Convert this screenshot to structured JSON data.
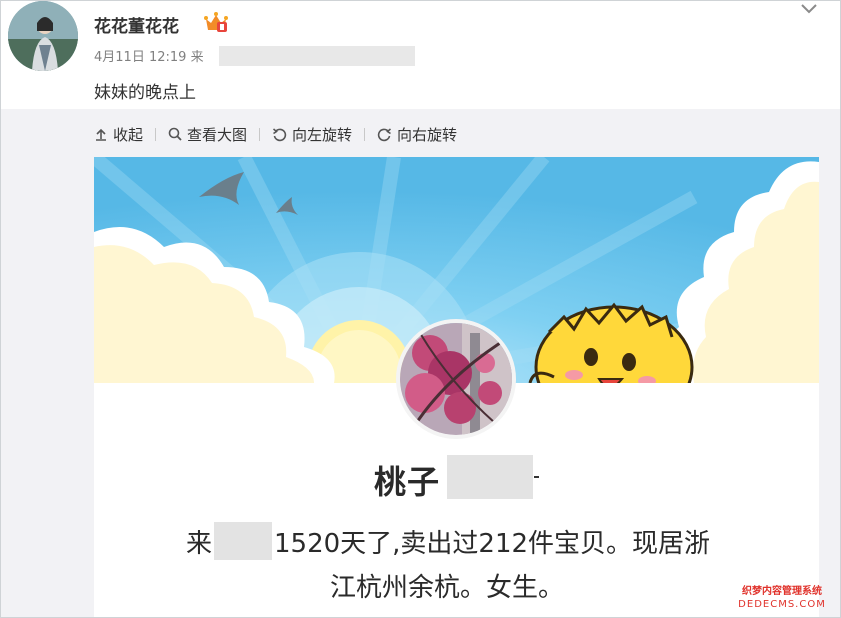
{
  "post": {
    "author": "花花董花花",
    "timestamp": "4月11日 12:19",
    "source_prefix": "来",
    "text": "妹妹的晚点上"
  },
  "toolbar": {
    "collapse_label": "收起",
    "view_large_label": "查看大图",
    "rotate_left_label": "向左旋转",
    "rotate_right_label": "向右旋转"
  },
  "image_content": {
    "shop_name": "桃子",
    "description_prefix": "来",
    "description_line1": "1520天了,卖出过212件宝贝。现居浙",
    "description_line2": "江杭州余杭。女生。"
  },
  "watermark": {
    "line1": "织梦内容管理系统",
    "line2": "DEDECMS.COM"
  },
  "icons": [
    "chevron-down-icon",
    "vip-crown-icon",
    "collapse-icon",
    "search-icon",
    "rotate-left-icon",
    "rotate-right-icon"
  ],
  "colors": {
    "sky": "#64bfe8",
    "media_bg": "#f2f2f5",
    "badge_orange": "#f28c28",
    "watermark_red": "#e0322b"
  }
}
